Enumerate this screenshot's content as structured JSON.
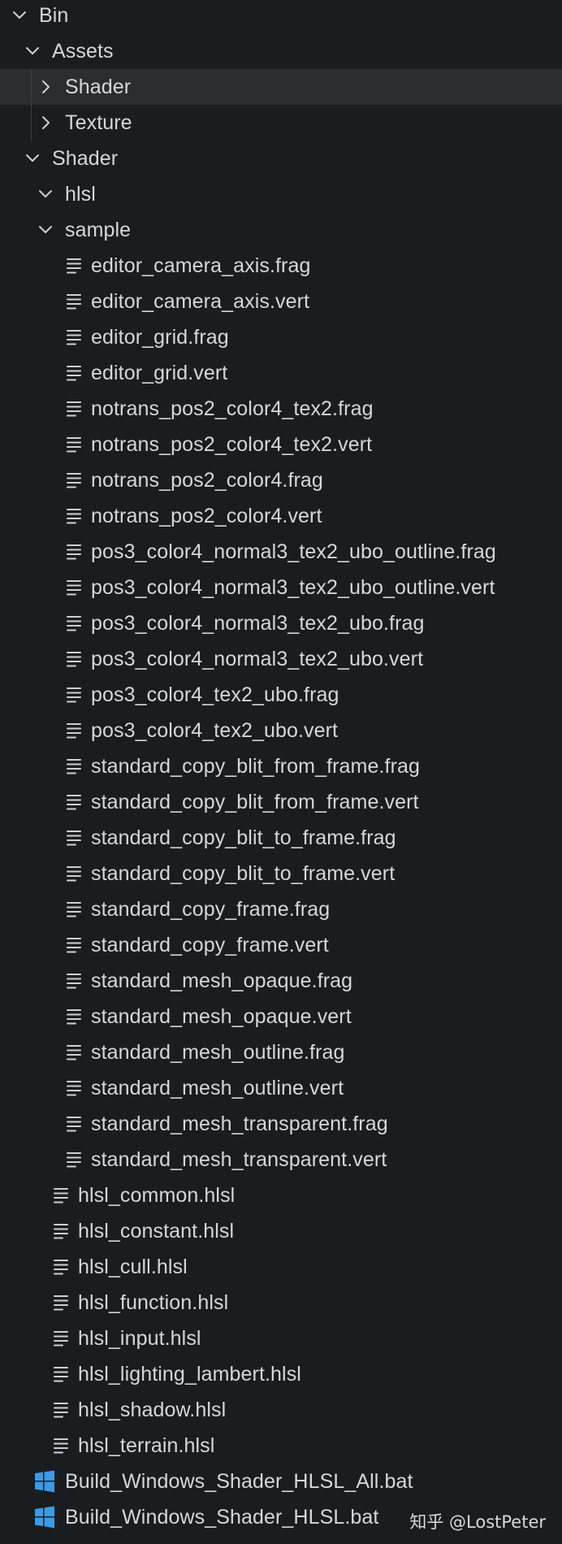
{
  "explorer": {
    "tree": [
      {
        "kind": "folder-open",
        "label": "Bin"
      },
      {
        "kind": "folder-open",
        "label": "Assets"
      },
      {
        "kind": "folder-closed",
        "label": "Shader",
        "selected": true
      },
      {
        "kind": "folder-closed",
        "label": "Texture"
      },
      {
        "kind": "folder-open",
        "label": "Shader"
      },
      {
        "kind": "folder-open",
        "label": "hlsl"
      },
      {
        "kind": "folder-open",
        "label": "sample"
      },
      {
        "kind": "file",
        "label": "editor_camera_axis.frag"
      },
      {
        "kind": "file",
        "label": "editor_camera_axis.vert"
      },
      {
        "kind": "file",
        "label": "editor_grid.frag"
      },
      {
        "kind": "file",
        "label": "editor_grid.vert"
      },
      {
        "kind": "file",
        "label": "notrans_pos2_color4_tex2.frag"
      },
      {
        "kind": "file",
        "label": "notrans_pos2_color4_tex2.vert"
      },
      {
        "kind": "file",
        "label": "notrans_pos2_color4.frag"
      },
      {
        "kind": "file",
        "label": "notrans_pos2_color4.vert"
      },
      {
        "kind": "file",
        "label": "pos3_color4_normal3_tex2_ubo_outline.frag"
      },
      {
        "kind": "file",
        "label": "pos3_color4_normal3_tex2_ubo_outline.vert"
      },
      {
        "kind": "file",
        "label": "pos3_color4_normal3_tex2_ubo.frag"
      },
      {
        "kind": "file",
        "label": "pos3_color4_normal3_tex2_ubo.vert"
      },
      {
        "kind": "file",
        "label": "pos3_color4_tex2_ubo.frag"
      },
      {
        "kind": "file",
        "label": "pos3_color4_tex2_ubo.vert"
      },
      {
        "kind": "file",
        "label": "standard_copy_blit_from_frame.frag"
      },
      {
        "kind": "file",
        "label": "standard_copy_blit_from_frame.vert"
      },
      {
        "kind": "file",
        "label": "standard_copy_blit_to_frame.frag"
      },
      {
        "kind": "file",
        "label": "standard_copy_blit_to_frame.vert"
      },
      {
        "kind": "file",
        "label": "standard_copy_frame.frag"
      },
      {
        "kind": "file",
        "label": "standard_copy_frame.vert"
      },
      {
        "kind": "file",
        "label": "standard_mesh_opaque.frag"
      },
      {
        "kind": "file",
        "label": "standard_mesh_opaque.vert"
      },
      {
        "kind": "file",
        "label": "standard_mesh_outline.frag"
      },
      {
        "kind": "file",
        "label": "standard_mesh_outline.vert"
      },
      {
        "kind": "file",
        "label": "standard_mesh_transparent.frag"
      },
      {
        "kind": "file",
        "label": "standard_mesh_transparent.vert"
      },
      {
        "kind": "file",
        "label": "hlsl_common.hlsl"
      },
      {
        "kind": "file",
        "label": "hlsl_constant.hlsl"
      },
      {
        "kind": "file",
        "label": "hlsl_cull.hlsl"
      },
      {
        "kind": "file",
        "label": "hlsl_function.hlsl"
      },
      {
        "kind": "file",
        "label": "hlsl_input.hlsl"
      },
      {
        "kind": "file",
        "label": "hlsl_lighting_lambert.hlsl"
      },
      {
        "kind": "file",
        "label": "hlsl_shadow.hlsl"
      },
      {
        "kind": "file",
        "label": "hlsl_terrain.hlsl"
      },
      {
        "kind": "windows-bat",
        "label": "Build_Windows_Shader_HLSL_All.bat"
      },
      {
        "kind": "windows-bat",
        "label": "Build_Windows_Shader_HLSL.bat"
      }
    ]
  },
  "watermark": "知乎 @LostPeter",
  "colors": {
    "background": "#1b1c1f",
    "selected_row": "#2b2d31",
    "text": "#d7d7d7",
    "windows_blue": "#3a9be6"
  },
  "icons": {
    "folder_open": "chevron-down-icon",
    "folder_closed": "chevron-right-icon",
    "file": "file-lines-icon",
    "bat": "windows-logo-icon"
  }
}
